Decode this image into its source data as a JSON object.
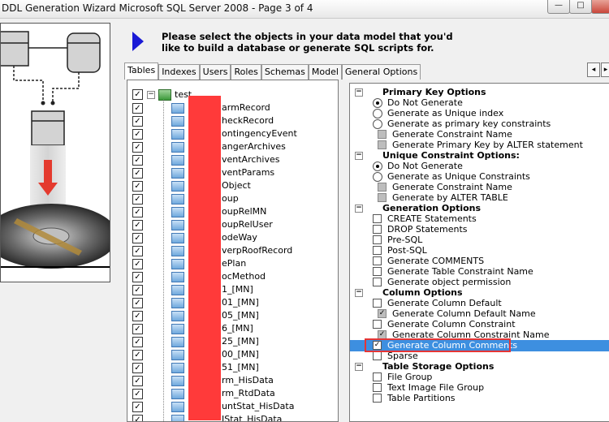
{
  "window": {
    "title": "DDL Generation Wizard Microsoft SQL Server 2008 - Page 3 of 4",
    "minimize_symbol": "—",
    "restore_symbol": "□"
  },
  "instruction": {
    "line1": "Please select the objects in your data model that you'd",
    "line2": "like to build a database or generate SQL scripts for."
  },
  "tabs": [
    {
      "label": "Tables",
      "active": true
    },
    {
      "label": "Indexes",
      "active": false
    },
    {
      "label": "Users",
      "active": false
    },
    {
      "label": "Roles",
      "active": false
    },
    {
      "label": "Schemas",
      "active": false
    },
    {
      "label": "Model",
      "active": false
    },
    {
      "label": "General Options",
      "active": false
    }
  ],
  "tree": {
    "root_label": "test",
    "items": [
      "armRecord",
      "heckRecord",
      "ontingencyEvent",
      "angerArchives",
      "ventArchives",
      "ventParams",
      "Object",
      "oup",
      "oupRelMN",
      "oupRelUser",
      "odeWay",
      "verpRoofRecord",
      "ePlan",
      "ocMethod",
      "1_[MN]",
      "01_[MN]",
      "05_[MN]",
      "6_[MN]",
      "25_[MN]",
      "00_[MN]",
      "51_[MN]",
      "rm_HisData",
      "rm_RtdData",
      "untStat_HisData",
      "JStat_HisData"
    ]
  },
  "options": [
    {
      "kind": "section",
      "label": "Primary Key Options",
      "expander": "−"
    },
    {
      "kind": "radio",
      "label": "Do Not Generate",
      "checked": true,
      "indent": 1
    },
    {
      "kind": "radio",
      "label": "Generate as Unique index",
      "checked": false,
      "indent": 1
    },
    {
      "kind": "radio",
      "label": "Generate as primary key constraints",
      "checked": false,
      "indent": 1
    },
    {
      "kind": "grey",
      "label": "Generate Constraint Name",
      "checked": false,
      "indent": 2
    },
    {
      "kind": "grey",
      "label": "Generate Primary Key by ALTER statement",
      "checked": false,
      "indent": 2
    },
    {
      "kind": "section",
      "label": "Unique Constraint Options:",
      "expander": "−"
    },
    {
      "kind": "radio",
      "label": "Do Not Generate",
      "checked": true,
      "indent": 1
    },
    {
      "kind": "radio",
      "label": "Generate as Unique Constraints",
      "checked": false,
      "indent": 1
    },
    {
      "kind": "grey",
      "label": "Generate Constraint Name",
      "checked": false,
      "indent": 2
    },
    {
      "kind": "grey",
      "label": "Generate by ALTER TABLE",
      "checked": false,
      "indent": 2
    },
    {
      "kind": "section",
      "label": "Generation Options",
      "expander": "−"
    },
    {
      "kind": "check",
      "label": "CREATE Statements",
      "checked": false,
      "indent": 1
    },
    {
      "kind": "check",
      "label": "DROP Statements",
      "checked": false,
      "indent": 1
    },
    {
      "kind": "check",
      "label": "Pre-SQL",
      "checked": false,
      "indent": 1
    },
    {
      "kind": "check",
      "label": "Post-SQL",
      "checked": false,
      "indent": 1
    },
    {
      "kind": "check",
      "label": "Generate COMMENTS",
      "checked": false,
      "indent": 1
    },
    {
      "kind": "check",
      "label": "Generate Table Constraint Name",
      "checked": false,
      "indent": 1
    },
    {
      "kind": "check",
      "label": "Generate object permission",
      "checked": false,
      "indent": 1
    },
    {
      "kind": "section",
      "label": "Column Options",
      "expander": "−"
    },
    {
      "kind": "check",
      "label": "Generate Column Default",
      "checked": false,
      "indent": 1
    },
    {
      "kind": "grey",
      "label": "Generate Column Default Name",
      "checked": true,
      "indent": 2
    },
    {
      "kind": "check",
      "label": "Generate Column Constraint",
      "checked": false,
      "indent": 1
    },
    {
      "kind": "grey",
      "label": "Generate Column Constraint Name",
      "checked": true,
      "indent": 2
    },
    {
      "kind": "check",
      "label": "Generate Column Comments",
      "checked": true,
      "indent": 1,
      "selected": true
    },
    {
      "kind": "check",
      "label": "Sparse",
      "checked": false,
      "indent": 1
    },
    {
      "kind": "section",
      "label": "Table Storage Options",
      "expander": "−"
    },
    {
      "kind": "check",
      "label": "File Group",
      "checked": false,
      "indent": 1
    },
    {
      "kind": "check",
      "label": "Text Image File Group",
      "checked": false,
      "indent": 1
    },
    {
      "kind": "check",
      "label": "Table Partitions",
      "checked": false,
      "indent": 1
    }
  ],
  "colors": {
    "selection": "#3d8fe0",
    "highlight_box": "#e53535",
    "redaction": "#ff3a3a",
    "arrow": "#1a1ad6"
  }
}
